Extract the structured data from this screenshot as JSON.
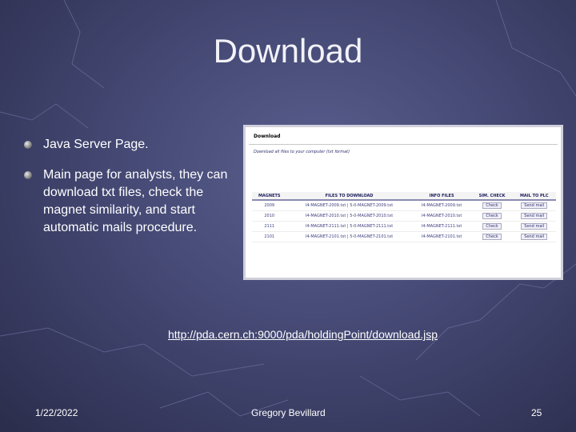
{
  "slide": {
    "title": "Download",
    "bullets": [
      "Java Server Page.",
      "Main page for analysts, they can download txt files, check the magnet similarity, and start automatic mails procedure."
    ],
    "link": "http://pda.cern.ch:9000/pda/holdingPoint/download.jsp",
    "footer": {
      "date": "1/22/2022",
      "author": "Gregory Bevillard",
      "page": "25"
    }
  },
  "screenshot": {
    "header": "Download",
    "subtitle": "Download all files to your computer (txt format)",
    "columns": [
      "MAGNETS",
      "FILES TO DOWNLOAD",
      "INFO FILES",
      "SIM. CHECK",
      "MAIL TO PLC"
    ],
    "rows": [
      {
        "magnet": "2009",
        "files": "I4-MAGNET-2009.txt | 5-0-MAGNET-2009.txt",
        "info": "I4-MAGNET-2009.txt",
        "check": "Check",
        "mail": "Send mail"
      },
      {
        "magnet": "2010",
        "files": "I4-MAGNET-2010.txt | 5-0-MAGNET-2010.txt",
        "info": "I4-MAGNET-2010.txt",
        "check": "Check",
        "mail": "Send mail"
      },
      {
        "magnet": "2111",
        "files": "I4-MAGNET-2111.txt | 5-0-MAGNET-2111.txt",
        "info": "I4-MAGNET-2111.txt",
        "check": "Check",
        "mail": "Send mail"
      },
      {
        "magnet": "2101",
        "files": "I4-MAGNET-2101.txt | 5-0-MAGNET-2101.txt",
        "info": "I4-MAGNET-2101.txt",
        "check": "Check",
        "mail": "Send mail"
      }
    ]
  }
}
